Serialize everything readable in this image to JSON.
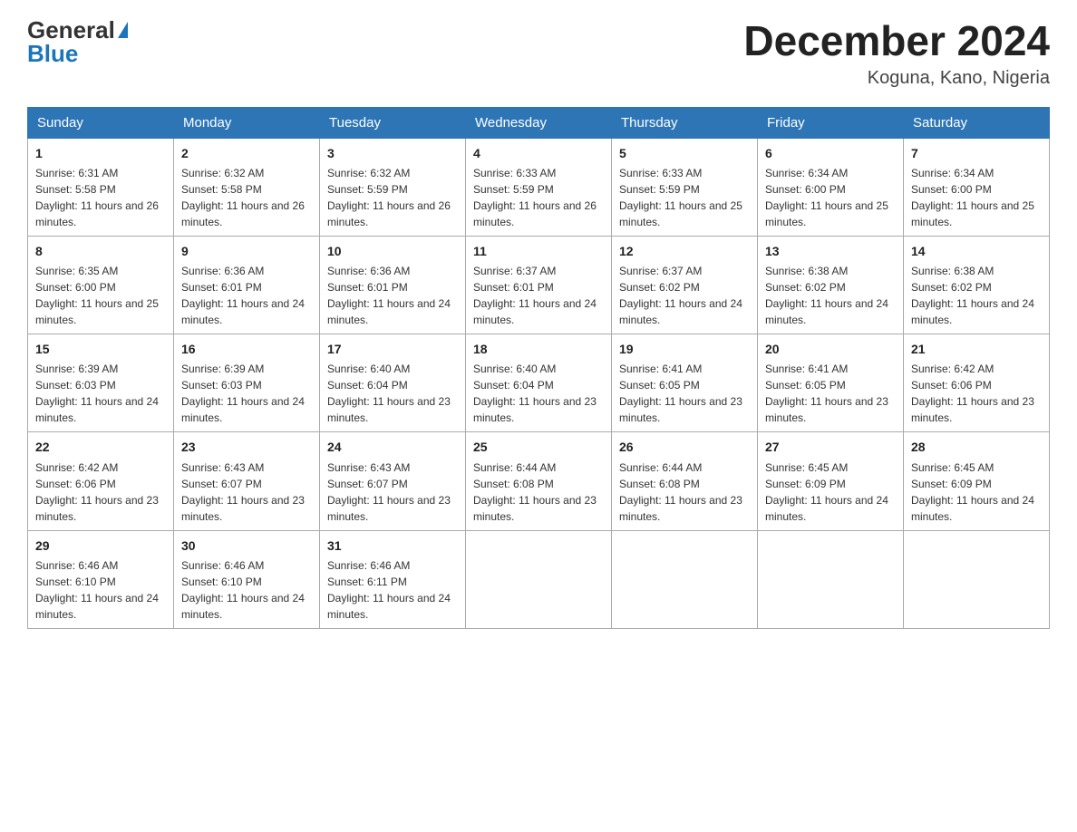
{
  "logo": {
    "general": "General",
    "blue": "Blue"
  },
  "header": {
    "month_year": "December 2024",
    "location": "Koguna, Kano, Nigeria"
  },
  "days_of_week": [
    "Sunday",
    "Monday",
    "Tuesday",
    "Wednesday",
    "Thursday",
    "Friday",
    "Saturday"
  ],
  "weeks": [
    [
      {
        "day": "1",
        "sunrise": "6:31 AM",
        "sunset": "5:58 PM",
        "daylight": "11 hours and 26 minutes."
      },
      {
        "day": "2",
        "sunrise": "6:32 AM",
        "sunset": "5:58 PM",
        "daylight": "11 hours and 26 minutes."
      },
      {
        "day": "3",
        "sunrise": "6:32 AM",
        "sunset": "5:59 PM",
        "daylight": "11 hours and 26 minutes."
      },
      {
        "day": "4",
        "sunrise": "6:33 AM",
        "sunset": "5:59 PM",
        "daylight": "11 hours and 26 minutes."
      },
      {
        "day": "5",
        "sunrise": "6:33 AM",
        "sunset": "5:59 PM",
        "daylight": "11 hours and 25 minutes."
      },
      {
        "day": "6",
        "sunrise": "6:34 AM",
        "sunset": "6:00 PM",
        "daylight": "11 hours and 25 minutes."
      },
      {
        "day": "7",
        "sunrise": "6:34 AM",
        "sunset": "6:00 PM",
        "daylight": "11 hours and 25 minutes."
      }
    ],
    [
      {
        "day": "8",
        "sunrise": "6:35 AM",
        "sunset": "6:00 PM",
        "daylight": "11 hours and 25 minutes."
      },
      {
        "day": "9",
        "sunrise": "6:36 AM",
        "sunset": "6:01 PM",
        "daylight": "11 hours and 24 minutes."
      },
      {
        "day": "10",
        "sunrise": "6:36 AM",
        "sunset": "6:01 PM",
        "daylight": "11 hours and 24 minutes."
      },
      {
        "day": "11",
        "sunrise": "6:37 AM",
        "sunset": "6:01 PM",
        "daylight": "11 hours and 24 minutes."
      },
      {
        "day": "12",
        "sunrise": "6:37 AM",
        "sunset": "6:02 PM",
        "daylight": "11 hours and 24 minutes."
      },
      {
        "day": "13",
        "sunrise": "6:38 AM",
        "sunset": "6:02 PM",
        "daylight": "11 hours and 24 minutes."
      },
      {
        "day": "14",
        "sunrise": "6:38 AM",
        "sunset": "6:02 PM",
        "daylight": "11 hours and 24 minutes."
      }
    ],
    [
      {
        "day": "15",
        "sunrise": "6:39 AM",
        "sunset": "6:03 PM",
        "daylight": "11 hours and 24 minutes."
      },
      {
        "day": "16",
        "sunrise": "6:39 AM",
        "sunset": "6:03 PM",
        "daylight": "11 hours and 24 minutes."
      },
      {
        "day": "17",
        "sunrise": "6:40 AM",
        "sunset": "6:04 PM",
        "daylight": "11 hours and 23 minutes."
      },
      {
        "day": "18",
        "sunrise": "6:40 AM",
        "sunset": "6:04 PM",
        "daylight": "11 hours and 23 minutes."
      },
      {
        "day": "19",
        "sunrise": "6:41 AM",
        "sunset": "6:05 PM",
        "daylight": "11 hours and 23 minutes."
      },
      {
        "day": "20",
        "sunrise": "6:41 AM",
        "sunset": "6:05 PM",
        "daylight": "11 hours and 23 minutes."
      },
      {
        "day": "21",
        "sunrise": "6:42 AM",
        "sunset": "6:06 PM",
        "daylight": "11 hours and 23 minutes."
      }
    ],
    [
      {
        "day": "22",
        "sunrise": "6:42 AM",
        "sunset": "6:06 PM",
        "daylight": "11 hours and 23 minutes."
      },
      {
        "day": "23",
        "sunrise": "6:43 AM",
        "sunset": "6:07 PM",
        "daylight": "11 hours and 23 minutes."
      },
      {
        "day": "24",
        "sunrise": "6:43 AM",
        "sunset": "6:07 PM",
        "daylight": "11 hours and 23 minutes."
      },
      {
        "day": "25",
        "sunrise": "6:44 AM",
        "sunset": "6:08 PM",
        "daylight": "11 hours and 23 minutes."
      },
      {
        "day": "26",
        "sunrise": "6:44 AM",
        "sunset": "6:08 PM",
        "daylight": "11 hours and 23 minutes."
      },
      {
        "day": "27",
        "sunrise": "6:45 AM",
        "sunset": "6:09 PM",
        "daylight": "11 hours and 24 minutes."
      },
      {
        "day": "28",
        "sunrise": "6:45 AM",
        "sunset": "6:09 PM",
        "daylight": "11 hours and 24 minutes."
      }
    ],
    [
      {
        "day": "29",
        "sunrise": "6:46 AM",
        "sunset": "6:10 PM",
        "daylight": "11 hours and 24 minutes."
      },
      {
        "day": "30",
        "sunrise": "6:46 AM",
        "sunset": "6:10 PM",
        "daylight": "11 hours and 24 minutes."
      },
      {
        "day": "31",
        "sunrise": "6:46 AM",
        "sunset": "6:11 PM",
        "daylight": "11 hours and 24 minutes."
      },
      null,
      null,
      null,
      null
    ]
  ]
}
